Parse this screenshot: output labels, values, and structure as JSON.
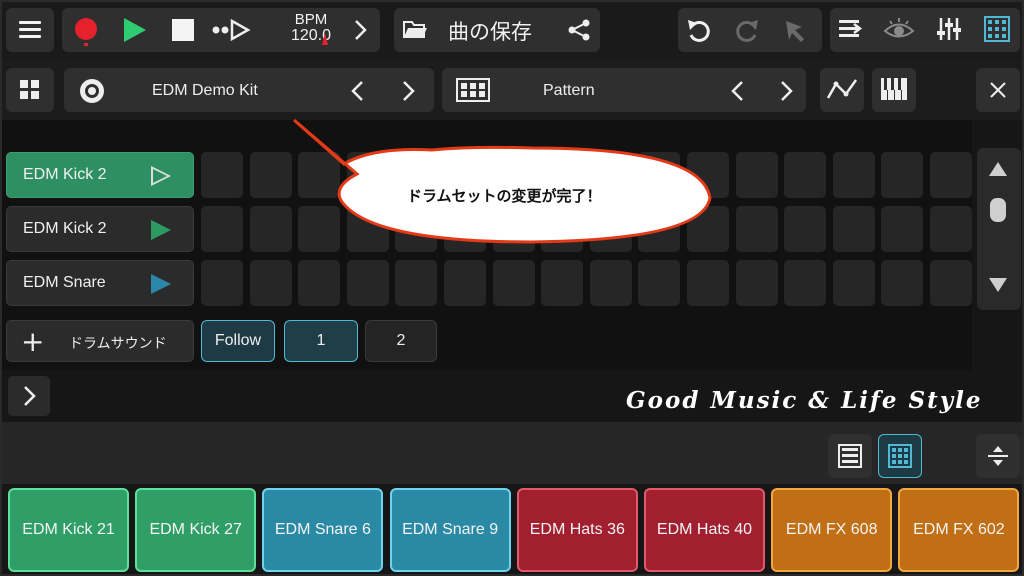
{
  "toolbar": {
    "bpm_label": "BPM",
    "bpm_value": "120.0",
    "save_label": "曲の保存"
  },
  "kit_bar": {
    "kit_name": "EDM Demo Kit",
    "pattern_name": "Pattern"
  },
  "tracks": [
    {
      "name": "EDM Kick 2",
      "active": true
    },
    {
      "name": "EDM Kick 2",
      "active": false
    },
    {
      "name": "EDM Snare",
      "active": false
    }
  ],
  "controls": {
    "add_drum_label": "ドラムサウンド",
    "follow_label": "Follow",
    "pattern_1": "1",
    "pattern_2": "2"
  },
  "callout": "ドラムセットの変更が完了！",
  "slogan": "Good Music & Life Style",
  "pads": [
    {
      "label": "EDM Kick 21",
      "color": "green"
    },
    {
      "label": "EDM Kick 27",
      "color": "green"
    },
    {
      "label": "EDM Snare 6",
      "color": "blue"
    },
    {
      "label": "EDM Snare 9",
      "color": "blue"
    },
    {
      "label": "EDM Hats 36",
      "color": "red"
    },
    {
      "label": "EDM Hats 40",
      "color": "red"
    },
    {
      "label": "EDM FX 608",
      "color": "orange"
    },
    {
      "label": "EDM FX 602",
      "color": "orange"
    }
  ],
  "colors": {
    "accent_cyan": "#4fb9d6",
    "record_red": "#e5212e",
    "play_green": "#2ecc71",
    "pad_green": "#2f9e67",
    "pad_blue": "#2a8aa6",
    "pad_red": "#a21f2f",
    "pad_orange": "#c06f14",
    "callout_border": "#e43a17"
  }
}
